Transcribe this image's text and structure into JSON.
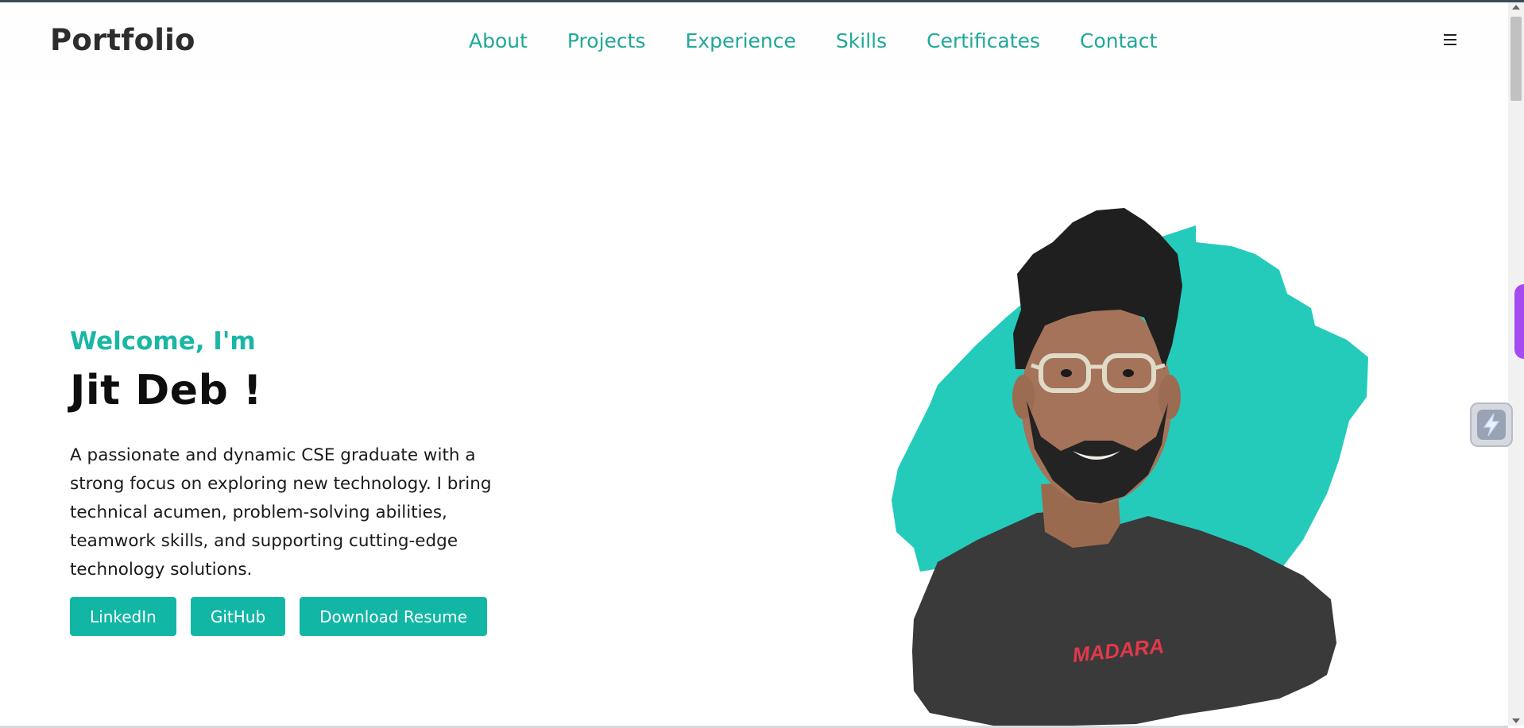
{
  "header": {
    "brand": "Portfolio",
    "nav": [
      {
        "label": "About"
      },
      {
        "label": "Projects"
      },
      {
        "label": "Experience"
      },
      {
        "label": "Skills"
      },
      {
        "label": "Certificates"
      },
      {
        "label": "Contact"
      }
    ],
    "menu_icon": "hamburger-icon"
  },
  "hero": {
    "welcome": "Welcome, I'm",
    "name": "Jit Deb !",
    "description": "A passionate and dynamic CSE graduate with a strong focus on exploring new technology. I bring technical acumen, problem-solving abilities, teamwork skills, and supporting cutting-edge technology solutions.",
    "buttons": [
      {
        "label": "LinkedIn"
      },
      {
        "label": "GitHub"
      },
      {
        "label": "Download Resume"
      }
    ],
    "portrait_alt": "portrait photo with teal paint splash",
    "shirt_logo": "MADARA"
  },
  "colors": {
    "accent": "#1bb6a6",
    "nav_link": "#1fa898",
    "button": "#12b6a5",
    "splash": "#24cbbb",
    "side_tab": "#a44cf0"
  },
  "widgets": {
    "floating_icon": "lightning-icon",
    "side_tab_icon": "side-tab-handle"
  }
}
